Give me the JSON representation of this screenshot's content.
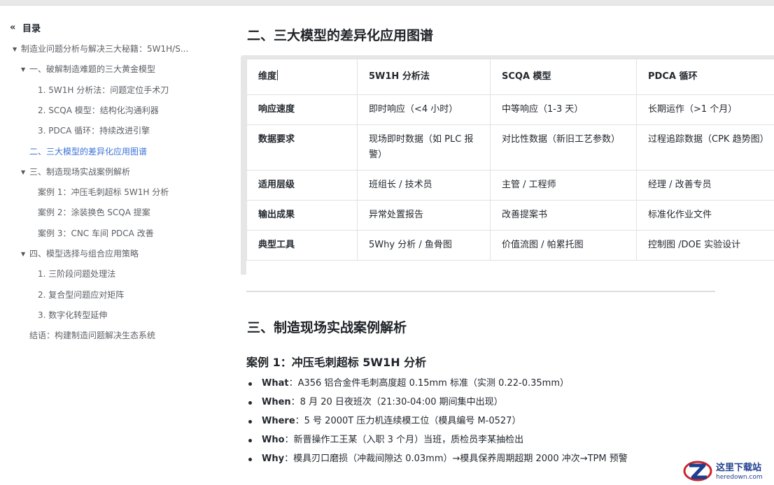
{
  "toc": {
    "header": "目录",
    "header_icon": "double-chevron-left-icon",
    "items": [
      {
        "label": "制造业问题分析与解决三大秘籍：5W1H/S...",
        "level": 0,
        "caret": true
      },
      {
        "label": "一、破解制造难题的三大黄金模型",
        "level": 1,
        "caret": true
      },
      {
        "label": "1. 5W1H 分析法：问题定位手术刀",
        "level": 2,
        "caret": false
      },
      {
        "label": "2. SCQA 模型：结构化沟通利器",
        "level": 2,
        "caret": false
      },
      {
        "label": "3. PDCA 循环：持续改进引擎",
        "level": 2,
        "caret": false
      },
      {
        "label": "二、三大模型的差异化应用图谱",
        "level": 1,
        "caret": false,
        "active": true
      },
      {
        "label": "三、制造现场实战案例解析",
        "level": 1,
        "caret": true
      },
      {
        "label": "案例 1：冲压毛刺超标 5W1H 分析",
        "level": 2,
        "caret": false
      },
      {
        "label": "案例 2：涂装换色 SCQA 提案",
        "level": 2,
        "caret": false
      },
      {
        "label": "案例 3：CNC 车间 PDCA 改善",
        "level": 2,
        "caret": false
      },
      {
        "label": "四、模型选择与组合应用策略",
        "level": 1,
        "caret": true
      },
      {
        "label": "1. 三阶段问题处理法",
        "level": 2,
        "caret": false
      },
      {
        "label": "2. 复合型问题应对矩阵",
        "level": 2,
        "caret": false
      },
      {
        "label": "3. 数字化转型延伸",
        "level": 2,
        "caret": false
      },
      {
        "label": "结语：构建制造问题解决生态系统",
        "level": 1,
        "caret": false
      }
    ]
  },
  "main": {
    "section2_title": "二、三大模型的差异化应用图谱",
    "table": {
      "headers": [
        "维度",
        "5W1H 分析法",
        "SCQA 模型",
        "PDCA 循环"
      ],
      "rows": [
        [
          "响应速度",
          "即时响应（<4 小时）",
          "中等响应（1-3 天）",
          "长期运作（>1 个月）"
        ],
        [
          "数据要求",
          "现场即时数据（如 PLC 报警）",
          "对比性数据（新旧工艺参数）",
          "过程追踪数据（CPK 趋势图）"
        ],
        [
          "适用层级",
          "班组长 / 技术员",
          "主管 / 工程师",
          "经理 / 改善专员"
        ],
        [
          "输出成果",
          "异常处置报告",
          "改善提案书",
          "标准化作业文件"
        ],
        [
          "典型工具",
          "5Why 分析 / 鱼骨图",
          "价值流图 / 帕累托图",
          "控制图 /DOE 实验设计"
        ]
      ]
    },
    "section3_title": "三、制造现场实战案例解析",
    "case1_title": "案例 1：冲压毛刺超标 5W1H 分析",
    "bullets": [
      {
        "key": "What",
        "text": "：A356 铝合金件毛刺高度超 0.15mm 标准（实测 0.22-0.35mm）"
      },
      {
        "key": "When",
        "text": "：8 月 20 日夜班次（21:30-04:00 期间集中出现）"
      },
      {
        "key": "Where",
        "text": "：5 号 2000T 压力机连续模工位（模具编号 M-0527）"
      },
      {
        "key": "Who",
        "text": "：新晋操作工王某（入职 3 个月）当班，质检员李某抽检出"
      },
      {
        "key": "Why",
        "text": "：模具刃口磨损（冲裁间隙达 0.03mm）→模具保养周期超期 2000 冲次→TPM 预警"
      }
    ]
  },
  "watermark": {
    "line1": "这里下载站",
    "line2": "heredown.com",
    "color": "#1d3e8f",
    "accent": "#c9252c"
  },
  "colors": {
    "toc_active": "#3b73d6",
    "table_border": "#dfe2e5"
  }
}
